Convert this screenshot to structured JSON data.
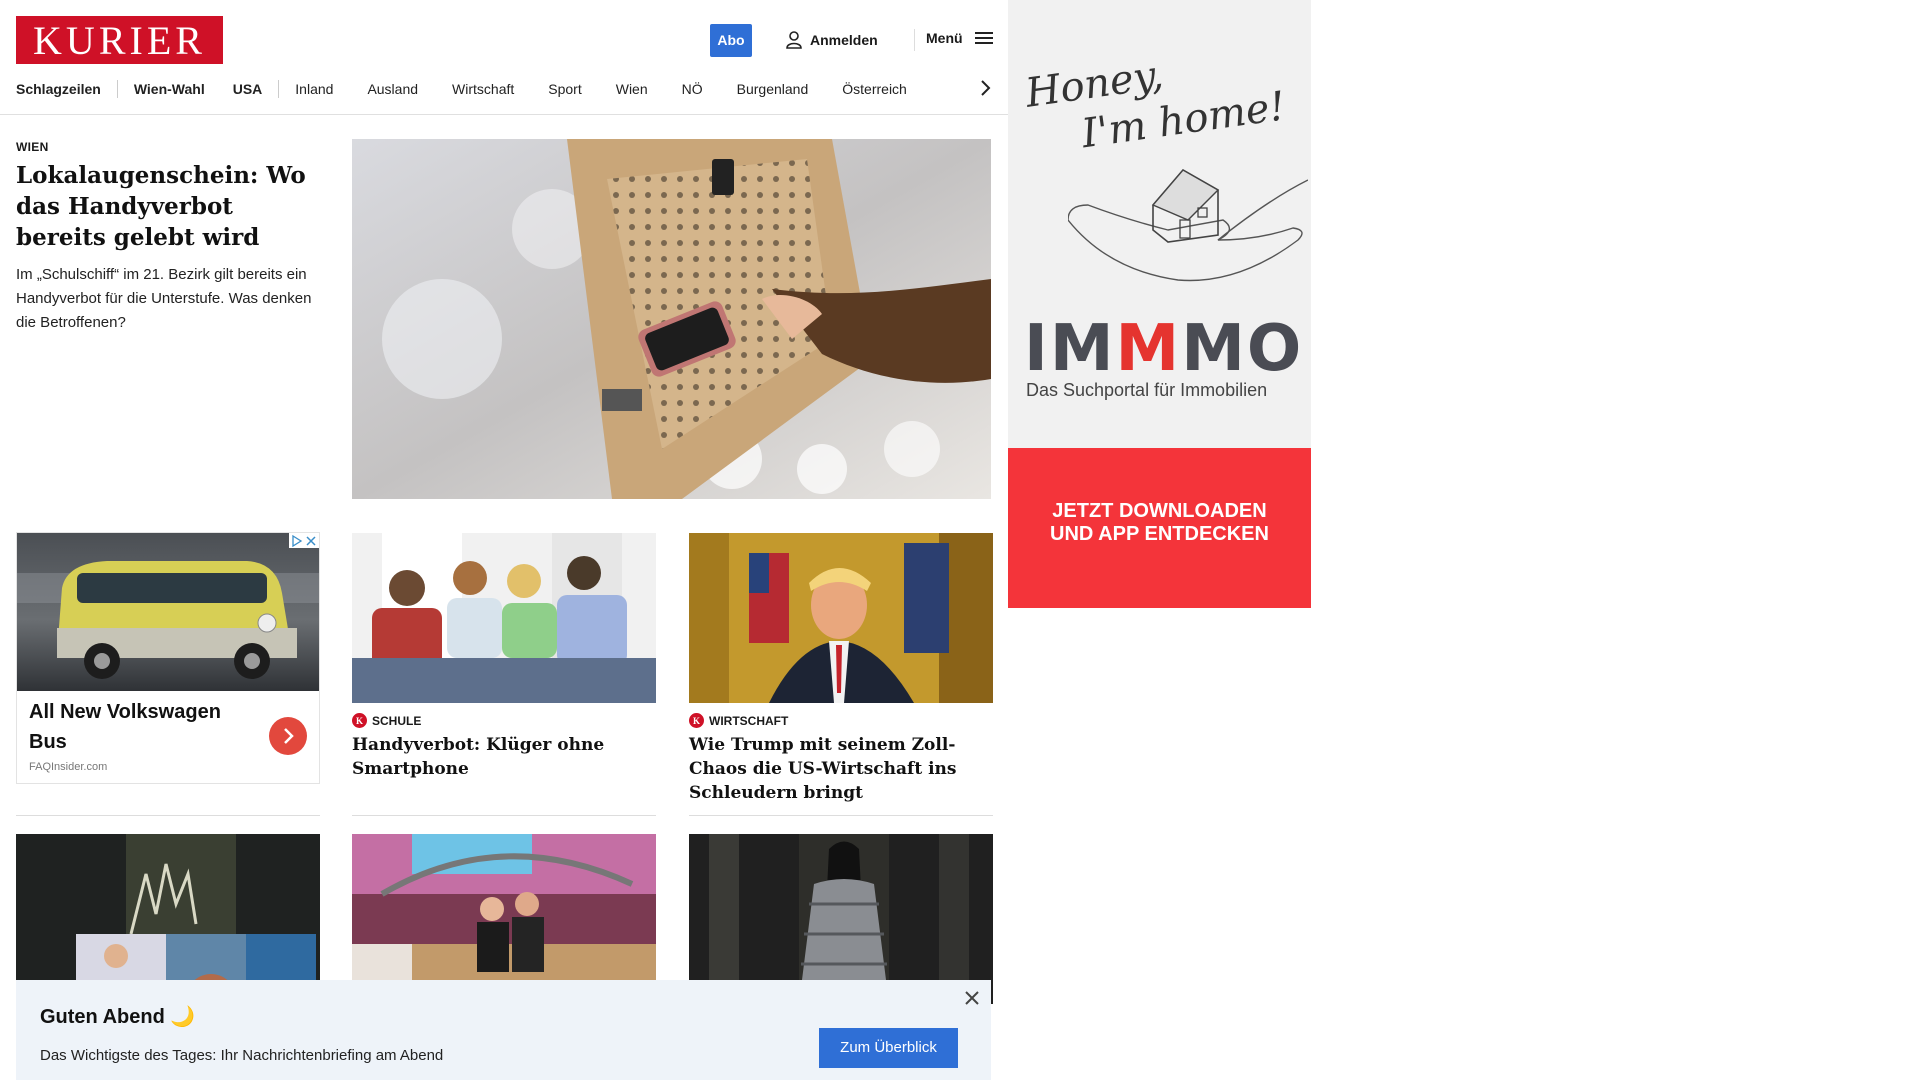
{
  "header": {
    "logo": "KURIER",
    "abo_label": "Abo",
    "login_label": "Anmelden",
    "menu_label": "Menü"
  },
  "nav": {
    "items": [
      "Schlagzeilen",
      "Wien-Wahl",
      "USA",
      "Inland",
      "Ausland",
      "Wirtschaft",
      "Sport",
      "Wien",
      "NÖ",
      "Burgenland",
      "Österreich"
    ]
  },
  "lead": {
    "topic": "WIEN",
    "title": "Lokalaugenschein: Wo das Handyverbot bereits gelebt wird",
    "teaser": "Im „Schulschiff“ im 21. Bezirk gilt bereits ein Handyverbot für die Unterstufe. Was denken die Betroffenen?"
  },
  "ad_card": {
    "title": "All New Volkswagen Bus",
    "source": "FAQInsider.com"
  },
  "cards": [
    {
      "topic": "SCHULE",
      "title": "Handyverbot: Klüger ohne Smartphone"
    },
    {
      "topic": "WIRTSCHAFT",
      "title": "Wie Trump mit seinem Zoll-Chaos die US-Wirtschaft ins Schleudern bringt"
    }
  ],
  "briefing": {
    "greeting": "Guten Abend 🌙",
    "subtitle": "Das Wichtigste des Tages: Ihr Nachrichtenbriefing am Abend",
    "button": "Zum Überblick"
  },
  "side_ad": {
    "script_line1": "Honey,",
    "script_line2": "I'm home!",
    "brand_a": "IM",
    "brand_b": "M",
    "brand_c": "MO",
    "tagline": "Das Suchportal für Immobilien",
    "cta_line1": "JETZT DOWNLOADEN",
    "cta_line2": "UND APP ENTDECKEN"
  },
  "colors": {
    "brand_red": "#cf1127",
    "accent_blue": "#2f6fd6",
    "ad_red": "#f4343a"
  }
}
